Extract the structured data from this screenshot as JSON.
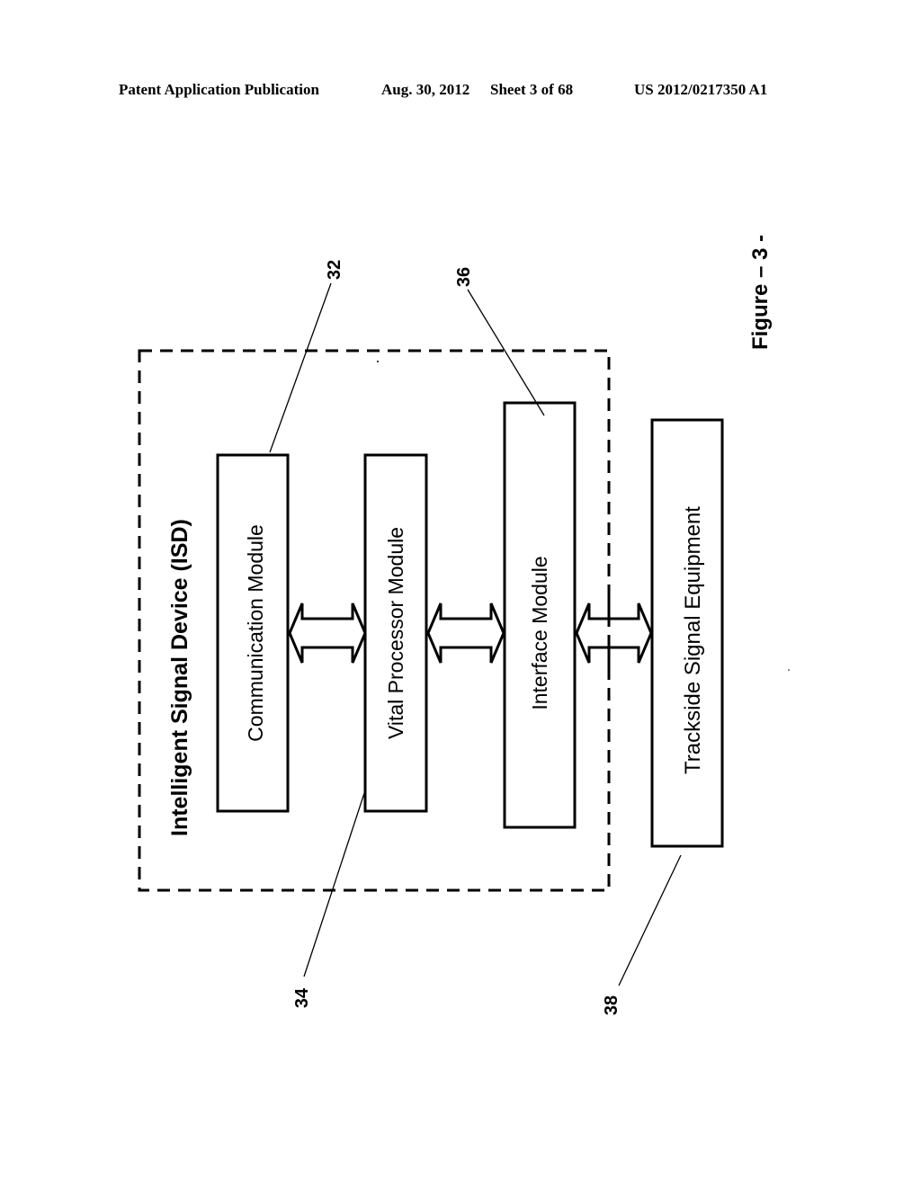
{
  "header": {
    "publication": "Patent Application Publication",
    "date": "Aug. 30, 2012",
    "sheet": "Sheet 3 of 68",
    "number": "US 2012/0217350 A1"
  },
  "figure": {
    "label": "Figure – 3 -",
    "container": {
      "title": "Intelligent Signal Device (ISD)"
    },
    "modules": [
      {
        "ref": "32",
        "label": "Communication Module"
      },
      {
        "ref": "34",
        "label": "Vital Processor Module"
      },
      {
        "ref": "36",
        "label": "Interface Module"
      },
      {
        "ref": "38",
        "label": "Trackside Signal Equipment"
      }
    ],
    "connections": [
      {
        "from": "Communication Module",
        "to": "Vital Processor Module",
        "type": "bidirectional"
      },
      {
        "from": "Vital Processor Module",
        "to": "Interface Module",
        "type": "bidirectional"
      },
      {
        "from": "Interface Module",
        "to": "Trackside Signal Equipment",
        "type": "bidirectional"
      }
    ]
  }
}
